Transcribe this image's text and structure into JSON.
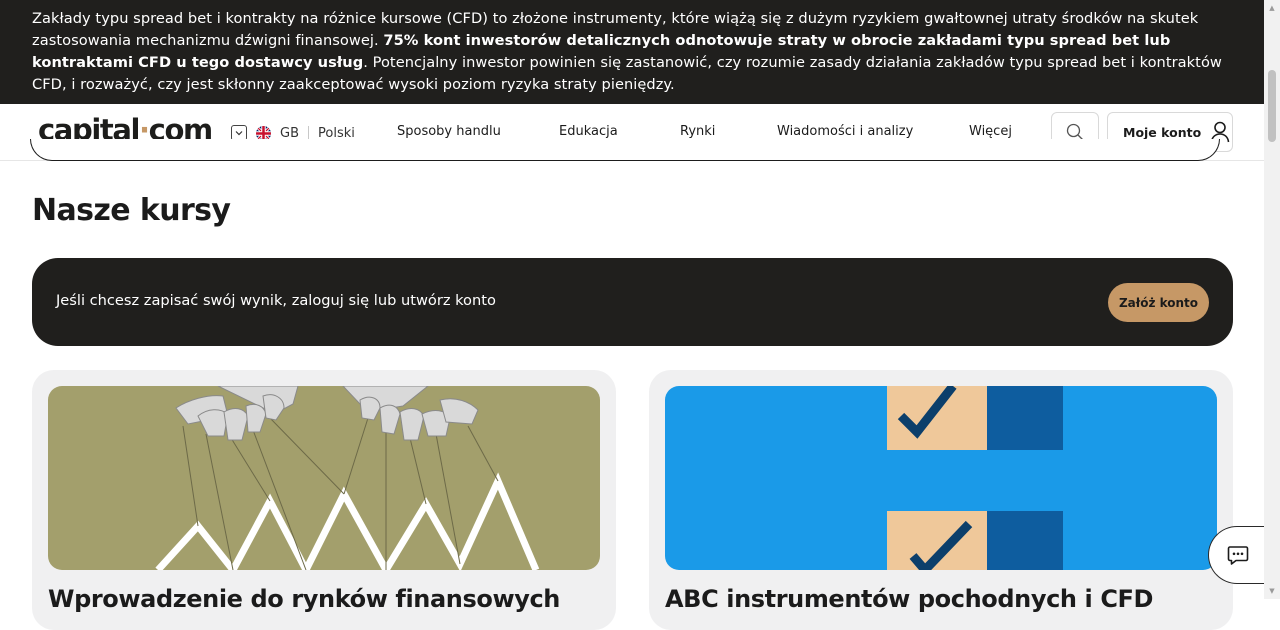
{
  "risk_banner": {
    "text_before": "Zakłady typu spread bet i kontrakty na różnice kursowe (CFD) to złożone instrumenty, które wiążą się z dużym ryzykiem gwałtownej utraty środków na skutek zastosowania mechanizmu dźwigni finansowej. ",
    "text_bold": "75% kont inwestorów detalicznych odnotowuje straty w obrocie zakładami typu spread bet lub kontraktami CFD u tego dostawcy usług",
    "text_after": ". Potencjalny inwestor powinien się zastanowić, czy rozumie zasady działania zakładów typu spread bet i kontraktów CFD, i rozważyć, czy jest skłonny zaakceptować wysoki poziom ryzyka straty pieniędzy."
  },
  "header": {
    "logo_part1": "capital",
    "logo_dot": "·",
    "logo_part2": "com",
    "region_code": "GB",
    "language": "Polski",
    "nav": [
      "Sposoby handlu",
      "Edukacja",
      "Rynki",
      "Wiadomości i analizy",
      "Więcej"
    ],
    "account_label": "Moje konto"
  },
  "main": {
    "section_title": "Nasze kursy",
    "login_prompt": "Jeśli chcesz zapisać swój wynik, zaloguj się lub utwórz konto",
    "signup_label": "Załóż konto",
    "cards": [
      {
        "title": "Wprowadzenie do rynków finansowych"
      },
      {
        "title": "ABC instrumentów pochodnych i CFD"
      }
    ]
  },
  "colors": {
    "banner_bg": "#201f1d",
    "accent": "#c69866",
    "card_bg": "#f0f0f1",
    "card1_image_bg": "#a39f6c",
    "card2_image_bg": "#1a9ae8"
  },
  "icons": [
    "chevron-down-icon",
    "uk-flag-icon",
    "search-icon",
    "user-icon",
    "chat-icon"
  ]
}
